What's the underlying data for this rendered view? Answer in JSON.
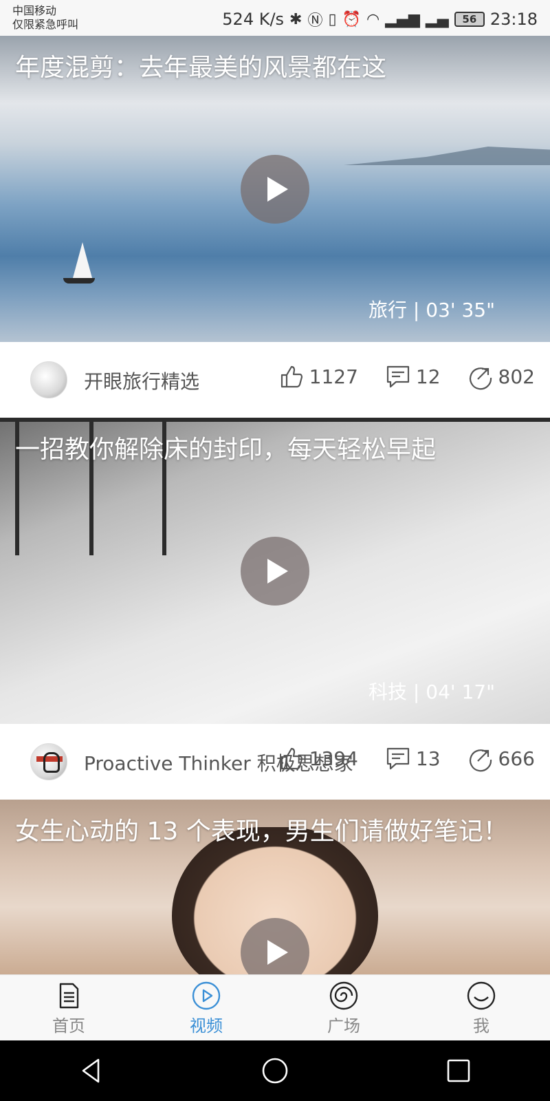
{
  "status_bar": {
    "carrier_line1": "中国移动",
    "carrier_line2": "仅限紧急呼叫",
    "speed": "524 K/s",
    "battery": "56",
    "time": "23:18",
    "icons": [
      "bluetooth-icon",
      "nfc-icon",
      "vibrate-icon",
      "alarm-icon",
      "wifi-icon",
      "signal-4g-icon",
      "signal-icon"
    ]
  },
  "feed": [
    {
      "title": "年度混剪：去年最美的风景都在这",
      "category": "旅行",
      "separator": "|",
      "duration": "03' 35\"",
      "author": "开眼旅行精选",
      "likes": "1127",
      "comments": "12",
      "shares": "802"
    },
    {
      "title": "一招教你解除床的封印，每天轻松早起",
      "category": "科技",
      "separator": "|",
      "duration": "04' 17\"",
      "author": "Proactive Thinker 积极思想家",
      "likes": "1394",
      "comments": "13",
      "shares": "666"
    },
    {
      "title": "女生心动的 13 个表现，男生们请做好笔记！"
    }
  ],
  "bottom_nav": {
    "items": [
      {
        "label": "首页",
        "icon": "document-icon"
      },
      {
        "label": "视频",
        "icon": "play-circle-icon",
        "active": true
      },
      {
        "label": "广场",
        "icon": "swirl-icon"
      },
      {
        "label": "我",
        "icon": "smile-icon"
      }
    ]
  },
  "colors": {
    "accent": "#3a8fd6",
    "text_secondary": "#555555"
  }
}
